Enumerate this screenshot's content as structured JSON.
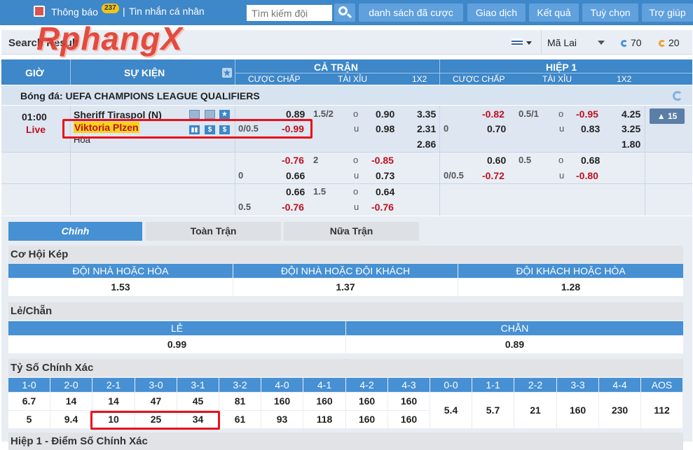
{
  "topbar": {
    "notif_label": "Thông báo",
    "notif_count": "237",
    "sep": "|",
    "inbox_label": "Tin nhắn cá nhân",
    "search_placeholder": "Tìm kiếm đội",
    "buttons": [
      "danh sách đã cược",
      "Giao dịch",
      "Kết quả",
      "Tuỳ chọn",
      "Trợ giúp"
    ]
  },
  "logo_text": "RphangX",
  "subbar": {
    "title": "Search Result",
    "odds_type": "Mã Lai",
    "count_a": "70",
    "count_b": "20"
  },
  "header": {
    "col_time": "GIỜ",
    "col_event": "SỰ KIỆN",
    "full": "CẢ TRẬN",
    "half": "HIỆP 1",
    "handicap": "CƯỢC CHẤP",
    "overunder": "TÀI XỈU",
    "x12": "1X2",
    "handicap2": "CƯỢC CHẤP",
    "overunder2": "TÀI XỈU",
    "x12b": "1X2"
  },
  "league": "Bóng đá: UEFA CHAMPIONS LEAGUE QUALIFIERS",
  "match": {
    "time": "01:00",
    "status": "Live",
    "home": "Sheriff Tiraspol (N)",
    "away": "Viktoria Plzen",
    "draw": "Hòa",
    "more": "15"
  },
  "odds": {
    "r1": {
      "h1": "0.89",
      "ou_line": "1.5/2",
      "ou_o": "o",
      "ou_1": "0.90",
      "x_1": "3.35",
      "hh1": "-0.82",
      "hou_line": "0.5/1",
      "hou_o": "o",
      "hou_1": "-0.95",
      "hx1": "4.25",
      "line": "0/0.5",
      "h2": "-0.99",
      "ou_u": "u",
      "ou_2": "0.98",
      "x_2": "2.31",
      "hline": "0",
      "hh2": "0.70",
      "hou_u": "u",
      "hou_2": "0.83",
      "hx2": "3.25",
      "x_3": "2.86",
      "hx3": "1.80"
    },
    "r2": {
      "h1": "-0.76",
      "ou_line": "2",
      "ou_o": "o",
      "ou_1": "-0.85",
      "hh1": "0.60",
      "hou_line": "0.5",
      "hou_o": "o",
      "hou_1": "0.68",
      "line": "0",
      "h2": "0.66",
      "ou_u": "u",
      "ou_2": "0.73",
      "hline": "0/0.5",
      "hh2": "-0.72",
      "hou_u": "u",
      "hou_2": "-0.80"
    },
    "r3": {
      "h1": "0.66",
      "ou_line": "1.5",
      "ou_o": "o",
      "ou_1": "0.64",
      "line": "0.5",
      "h2": "-0.76",
      "ou_u": "u",
      "ou_2": "-0.76"
    }
  },
  "tabs": [
    "Chính",
    "Toàn Trận",
    "Nữa Trận"
  ],
  "double_chance": {
    "title": "Cơ Hội Kép",
    "headers": [
      "ĐỘI NHÀ HOẶC HÒA",
      "ĐỘI NHÀ HOẶC ĐỘI KHÁCH",
      "ĐỘI KHÁCH HOẶC HÒA"
    ],
    "values": [
      "1.53",
      "1.37",
      "1.28"
    ]
  },
  "odd_even": {
    "title": "Lẻ/Chẵn",
    "headers": [
      "LẺ",
      "CHẴN"
    ],
    "values": [
      "0.99",
      "0.89"
    ]
  },
  "correct_score": {
    "title": "Tỷ Số Chính Xác",
    "headers": [
      "1-0",
      "2-0",
      "2-1",
      "3-0",
      "3-1",
      "3-2",
      "4-0",
      "4-1",
      "4-2",
      "4-3",
      "0-0",
      "1-1",
      "2-2",
      "3-3",
      "4-4",
      "AOS"
    ],
    "row1": [
      "6.7",
      "14",
      "14",
      "47",
      "45",
      "81",
      "160",
      "160",
      "160",
      "160"
    ],
    "row2": [
      "5",
      "9.4",
      "10",
      "25",
      "34",
      "61",
      "93",
      "118",
      "160",
      "160"
    ],
    "draws": [
      "5.4",
      "5.7",
      "21",
      "160",
      "230",
      "112"
    ]
  },
  "next_section": "Hiệp 1 - Điểm Số Chính Xác"
}
